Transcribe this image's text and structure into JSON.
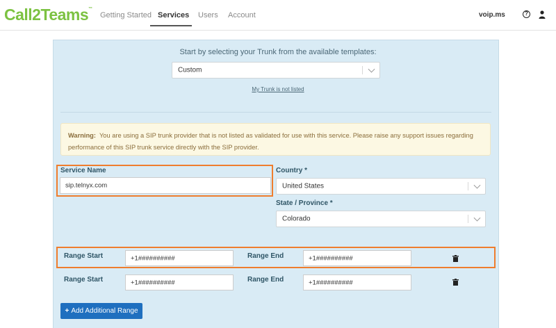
{
  "brand": {
    "logo_text": "Call2Teams",
    "trademark": "™"
  },
  "nav": {
    "tabs": [
      {
        "label": "Getting Started"
      },
      {
        "label": "Services"
      },
      {
        "label": "Users"
      },
      {
        "label": "Account"
      }
    ],
    "active_tab": "Services",
    "account_name": "voip.ms",
    "help_icon_glyph": "?"
  },
  "trunk": {
    "intro": "Start by selecting your Trunk from the available templates:",
    "selected": "Custom",
    "not_listed_link": "My Trunk is not listed"
  },
  "warning": {
    "title": "Warning:",
    "message": "You are using a SIP trunk provider that is not listed as validated for use with this service. Please raise any support issues regarding performance of this SIP trunk service directly with the SIP provider."
  },
  "service_name": {
    "label": "Service Name",
    "value": "sip.telnyx.com"
  },
  "country": {
    "label": "Country *",
    "value": "United States"
  },
  "state": {
    "label": "State / Province *",
    "value": "Colorado"
  },
  "ranges": [
    {
      "start_label": "Range Start",
      "start": "+1##########",
      "end_label": "Range End",
      "end": "+1##########"
    },
    {
      "start_label": "Range Start",
      "start": "+1##########",
      "end_label": "Range End",
      "end": "+1##########"
    }
  ],
  "add_range_button": {
    "plus": "+",
    "label": "Add Additional Range"
  },
  "colors": {
    "brand_green": "#7cc242",
    "panel_bg": "#d9ebf5",
    "highlight": "#ef7d2d",
    "primary_button": "#1f6fbf",
    "warning_bg": "#fcf8e3"
  }
}
